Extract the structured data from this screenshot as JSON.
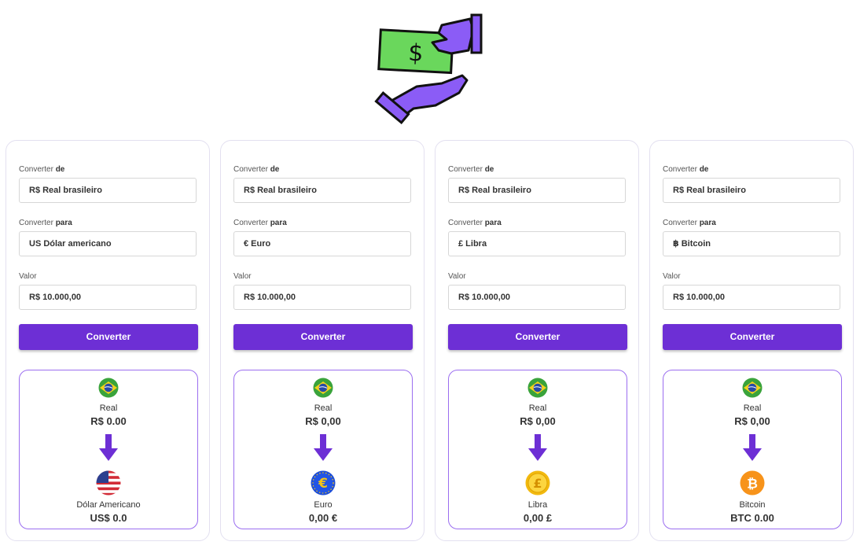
{
  "colors": {
    "accent": "#6d2fd5",
    "result_border": "#9b6ef0",
    "hand": "#8b5cf6",
    "bill": "#6ad75c"
  },
  "hero": {
    "icon": "money-exchange-icon"
  },
  "cards": [
    {
      "from_label": "Converter",
      "from_label_bold": "de",
      "from_value": "R$ Real brasileiro",
      "to_label": "Converter",
      "to_label_bold": "para",
      "to_value": "US Dólar americano",
      "amount_label": "Valor",
      "amount_value": "R$ 10.000,00",
      "button": "Converter",
      "result": {
        "from_name": "Real",
        "from_amount": "R$ 0.00",
        "to_name": "Dólar Americano",
        "to_amount": "US$ 0.0",
        "to_icon": "usa-flag-icon"
      }
    },
    {
      "from_label": "Converter",
      "from_label_bold": "de",
      "from_value": "R$ Real brasileiro",
      "to_label": "Converter",
      "to_label_bold": "para",
      "to_value": "€ Euro",
      "amount_label": "Valor",
      "amount_value": "R$ 10.000,00",
      "button": "Converter",
      "result": {
        "from_name": "Real",
        "from_amount": "R$ 0,00",
        "to_name": "Euro",
        "to_amount": "0,00 €",
        "to_icon": "euro-coin-icon"
      }
    },
    {
      "from_label": "Converter",
      "from_label_bold": "de",
      "from_value": "R$ Real brasileiro",
      "to_label": "Converter",
      "to_label_bold": "para",
      "to_value": "£ Libra",
      "amount_label": "Valor",
      "amount_value": "R$ 10.000,00",
      "button": "Converter",
      "result": {
        "from_name": "Real",
        "from_amount": "R$ 0,00",
        "to_name": "Libra",
        "to_amount": "0,00 £",
        "to_icon": "pound-coin-icon"
      }
    },
    {
      "from_label": "Converter",
      "from_label_bold": "de",
      "from_value": "R$ Real brasileiro",
      "to_label": "Converter",
      "to_label_bold": "para",
      "to_value": "฿ Bitcoin",
      "amount_label": "Valor",
      "amount_value": "R$ 10.000,00",
      "button": "Converter",
      "result": {
        "from_name": "Real",
        "from_amount": "R$ 0,00",
        "to_name": "Bitcoin",
        "to_amount": "BTC 0.00",
        "to_icon": "bitcoin-coin-icon"
      }
    }
  ]
}
